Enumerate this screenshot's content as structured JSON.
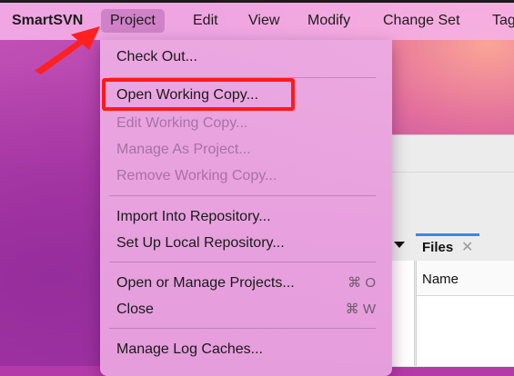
{
  "menubar": {
    "app_name": "SmartSVN",
    "items": [
      "Project",
      "Edit",
      "View",
      "Modify",
      "Change Set",
      "Tag"
    ]
  },
  "project_menu": {
    "check_out": "Check Out...",
    "open_working_copy": "Open Working Copy...",
    "edit_working_copy": "Edit Working Copy...",
    "manage_as_project": "Manage As Project...",
    "remove_working_copy": "Remove Working Copy...",
    "import_into_repository": "Import Into Repository...",
    "set_up_local_repository": "Set Up Local Repository...",
    "open_or_manage_projects": "Open or Manage Projects...",
    "open_or_manage_shortcut": "⌘ O",
    "close": "Close",
    "close_shortcut": "⌘ W",
    "manage_log_caches": "Manage Log Caches..."
  },
  "background_window": {
    "tab_label": "Files",
    "tab_close": "✕",
    "column_name": "Name"
  },
  "colors": {
    "highlight": "#ff1a1a",
    "annotation_arrow": "#ff2020",
    "tab_accent": "#3d86e6"
  }
}
